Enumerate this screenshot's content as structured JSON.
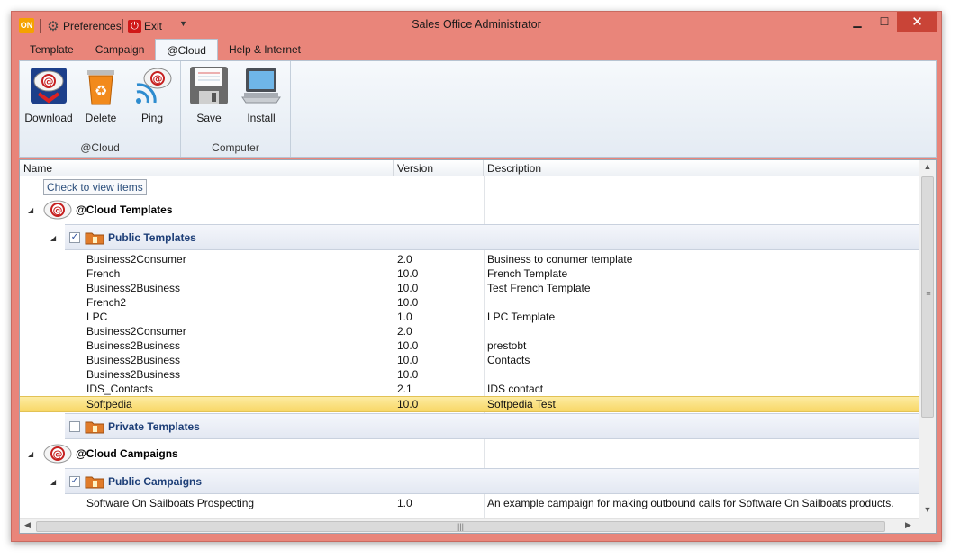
{
  "window": {
    "title": "Sales Office Administrator",
    "logo_text": "ON",
    "accent": "#e9857a"
  },
  "quick_access": {
    "preferences": "Preferences",
    "exit": "Exit"
  },
  "tabs": [
    {
      "label": "Template"
    },
    {
      "label": "Campaign"
    },
    {
      "label": "@Cloud"
    },
    {
      "label": "Help & Internet"
    }
  ],
  "active_tab": "@Cloud",
  "ribbon": {
    "groups": [
      {
        "label": "@Cloud",
        "buttons": [
          "Download",
          "Delete",
          "Ping"
        ]
      },
      {
        "label": "Computer",
        "buttons": [
          "Save",
          "Install"
        ]
      }
    ]
  },
  "list": {
    "columns": [
      "Name",
      "Version",
      "Description"
    ],
    "hint": "Check to view items",
    "cloud_templates": {
      "title": "@Cloud Templates",
      "public": {
        "title": "Public Templates",
        "checked": true,
        "rows": [
          {
            "name": "Business2Consumer",
            "version": "2.0",
            "description": "Business to conumer template"
          },
          {
            "name": "French",
            "version": "10.0",
            "description": "French Template"
          },
          {
            "name": "Business2Business",
            "version": "10.0",
            "description": "Test French Template"
          },
          {
            "name": "French2",
            "version": "10.0",
            "description": ""
          },
          {
            "name": "LPC",
            "version": "1.0",
            "description": "LPC Template"
          },
          {
            "name": "Business2Consumer",
            "version": "2.0",
            "description": ""
          },
          {
            "name": "Business2Business",
            "version": "10.0",
            "description": "prestobt"
          },
          {
            "name": "Business2Business",
            "version": "10.0",
            "description": "Contacts"
          },
          {
            "name": "Business2Business",
            "version": "10.0",
            "description": ""
          },
          {
            "name": "IDS_Contacts",
            "version": "2.1",
            "description": "IDS contact"
          },
          {
            "name": "Softpedia",
            "version": "10.0",
            "description": "Softpedia Test",
            "selected": true
          }
        ]
      },
      "private": {
        "title": "Private Templates",
        "checked": false
      }
    },
    "cloud_campaigns": {
      "title": "@Cloud Campaigns",
      "public": {
        "title": "Public Campaigns",
        "checked": true,
        "rows": [
          {
            "name": "Software On Sailboats Prospecting",
            "version": "1.0",
            "description": "An example campaign for making outbound calls for Software On Sailboats products."
          }
        ]
      }
    }
  }
}
